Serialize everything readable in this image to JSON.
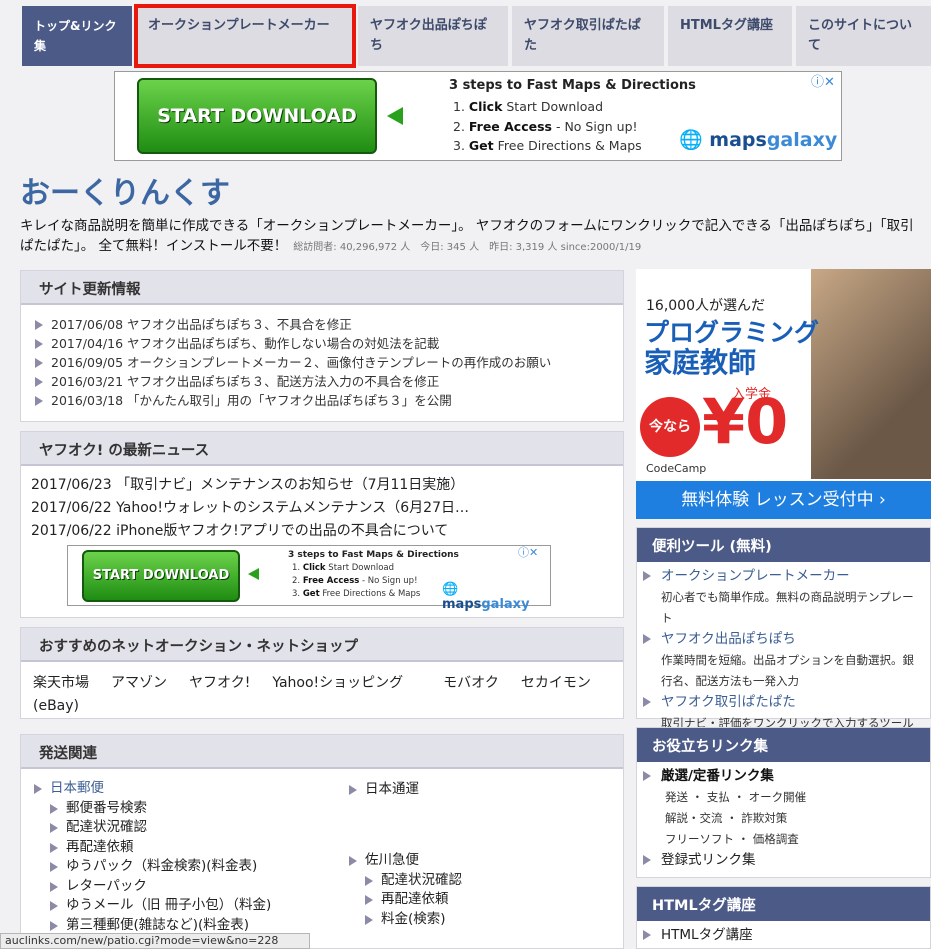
{
  "nav": {
    "tabs": [
      {
        "label": "トップ&リンク集"
      },
      {
        "label": "オークションプレートメーカー"
      },
      {
        "label": "ヤフオク出品ぽちぽち"
      },
      {
        "label": "ヤフオク取引ぱたぱた"
      },
      {
        "label": "HTMLタグ講座"
      },
      {
        "label": "このサイトについて"
      }
    ]
  },
  "ad": {
    "button": "START DOWNLOAD",
    "headline": "3 steps to Fast Maps & Directions",
    "steps": [
      {
        "num": "1.",
        "bold": "Click",
        "rest": " Start Download"
      },
      {
        "num": "2.",
        "bold": "Free Access",
        "rest": " - No Sign up!"
      },
      {
        "num": "3.",
        "bold": "Get",
        "rest": " Free Directions & Maps"
      }
    ],
    "logo_a": "maps",
    "logo_b": "galaxy"
  },
  "site": {
    "title": "おーくりんくす",
    "intro": "キレイな商品説明を簡単に作成できる「オークションプレートメーカー」。 ヤフオクのフォームにワンクリックで記入できる「出品ぽちぽち」「取引ぱたぱた」。 全て無料！インストール不要！",
    "stats": "総訪問者: 40,296,972 人　今日: 345 人　昨日: 3,319 人 since:2000/1/19"
  },
  "updates": {
    "title": "サイト更新情報",
    "items": [
      "2017/06/08 ヤフオク出品ぽちぽち３、不具合を修正",
      "2017/04/16 ヤフオク出品ぽちぽち、動作しない場合の対処法を記載",
      "2016/09/05 オークションプレートメーカー２、画像付きテンプレートの再作成のお願い",
      "2016/03/21 ヤフオク出品ぽちぽち３、配送方法入力の不具合を修正",
      "2016/03/18 「かんたん取引」用の「ヤフオク出品ぽちぽち３」を公開"
    ]
  },
  "news": {
    "title": "ヤフオク! の最新ニュース",
    "items": [
      "2017/06/23 「取引ナビ」メンテナンスのお知らせ（7月11日実施）",
      "2017/06/22 Yahoo!ウォレットのシステムメンテナンス（6月27日…",
      "2017/06/22 iPhone版ヤフオク!アプリでの出品の不具合について"
    ]
  },
  "shops": {
    "title": "おすすめのネットオークション・ネットショップ",
    "items": [
      "楽天市場",
      "アマゾン",
      "ヤフオク!",
      "Yahoo!ショッピング",
      "モバオク",
      "セカイモン(eBay)"
    ]
  },
  "shipping": {
    "title": "発送関連",
    "col1": [
      {
        "label": "日本郵便",
        "sub": false,
        "link": true
      },
      {
        "label": "郵便番号検索",
        "sub": true
      },
      {
        "label": "配達状況確認",
        "sub": true
      },
      {
        "label": "再配達依頼",
        "sub": true
      },
      {
        "label": "ゆうパック（料金検索)(料金表)",
        "sub": true
      },
      {
        "label": "レターパック",
        "sub": true
      },
      {
        "label": "ゆうメール（旧 冊子小包）（料金)",
        "sub": true
      },
      {
        "label": "第三種郵便(雑誌など)(料金表)",
        "sub": true
      }
    ],
    "col2a": [
      {
        "label": "日本通運",
        "sub": false
      }
    ],
    "col2b": [
      {
        "label": "佐川急便",
        "sub": false
      },
      {
        "label": "配達状況確認",
        "sub": true
      },
      {
        "label": "再配達依頼",
        "sub": true
      },
      {
        "label": "料金(検索)",
        "sub": true
      }
    ]
  },
  "side_ad": {
    "line1": "16,000人が選んだ",
    "line2": "プログラミング",
    "line3": "家庭教師",
    "badge": "今なら",
    "fee_label": "入学金",
    "price": "¥0",
    "brand": "CodeCamp",
    "cta": "無料体験 レッスン受付中 ›"
  },
  "tools": {
    "title": "便利ツール (無料)",
    "items": [
      {
        "label": "オークションプレートメーカー",
        "desc": "初心者でも簡単作成。無料の商品説明テンプレート"
      },
      {
        "label": "ヤフオク出品ぽちぽち",
        "desc": "作業時間を短縮。出品オプションを自動選択。銀行名、配送方法も一発入力"
      },
      {
        "label": "ヤフオク取引ぱたぱた",
        "desc": "取引ナビ・評価をワンクリックで入力するツール"
      }
    ]
  },
  "links": {
    "title": "お役立ちリンク集",
    "head": "厳選/定番リンク集",
    "rows": [
      "発送 ・ 支払 ・ オーク開催",
      "解説・交流 ・ 詐欺対策",
      "フリーソフト ・ 価格調査"
    ],
    "registered": "登録式リンク集"
  },
  "html_course": {
    "title": "HTMLタグ講座",
    "item": "HTMLタグ講座"
  },
  "statusbar": "auclinks.com/new/patio.cgi?mode=view&no=228"
}
